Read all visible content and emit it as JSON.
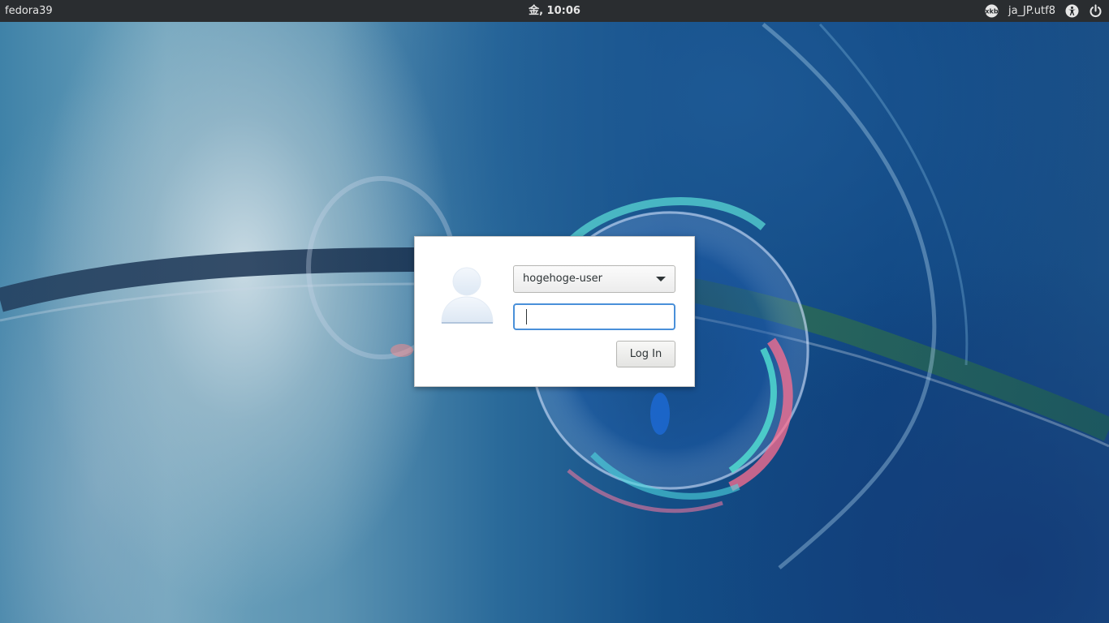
{
  "topbar": {
    "hostname": "fedora39",
    "clock": "金, 10:06",
    "keyboard_icon": "keyboard-layout-icon",
    "language": "ja_JP.utf8",
    "accessibility_icon": "accessibility-icon",
    "power_icon": "power-icon"
  },
  "login": {
    "avatar_icon": "user-avatar-icon",
    "selected_user": "hogehoge-user",
    "password_value": "",
    "login_button_label": "Log In"
  },
  "colors": {
    "topbar_bg": "#2a2d30",
    "focus_ring": "#4a90d9",
    "dialog_bg": "#ffffff"
  }
}
